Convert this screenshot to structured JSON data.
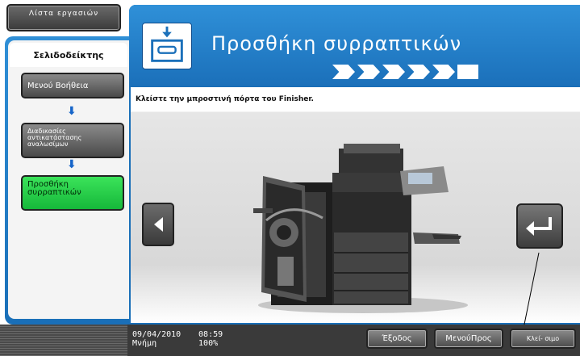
{
  "sidebar": {
    "list_button": "Λίστα εργασιών",
    "bookmark_tab": "Σελιδοδείκτης",
    "steps": [
      {
        "label": "Μενού Βοήθεια"
      },
      {
        "label": "Διαδικασίες αντικατάστασης αναλωσίμων"
      },
      {
        "label": "Προσθήκη συρραπτικών"
      }
    ]
  },
  "header": {
    "title": "Προσθήκη συρραπτικών",
    "progress_steps": 5
  },
  "main": {
    "instruction": "Κλείστε την μπροστινή πόρτα του Finisher."
  },
  "footer": {
    "date": "09/04/2010",
    "time": "08:59",
    "memory_label": "Μνήμη",
    "memory_value": "100%",
    "exit_button": "Έξοδος",
    "menu_button": "ΜενούΠρος",
    "close_button": "Κλεί- σιμο"
  },
  "colors": {
    "accent_blue": "#1b70ba",
    "active_step_green": "#22c744"
  }
}
